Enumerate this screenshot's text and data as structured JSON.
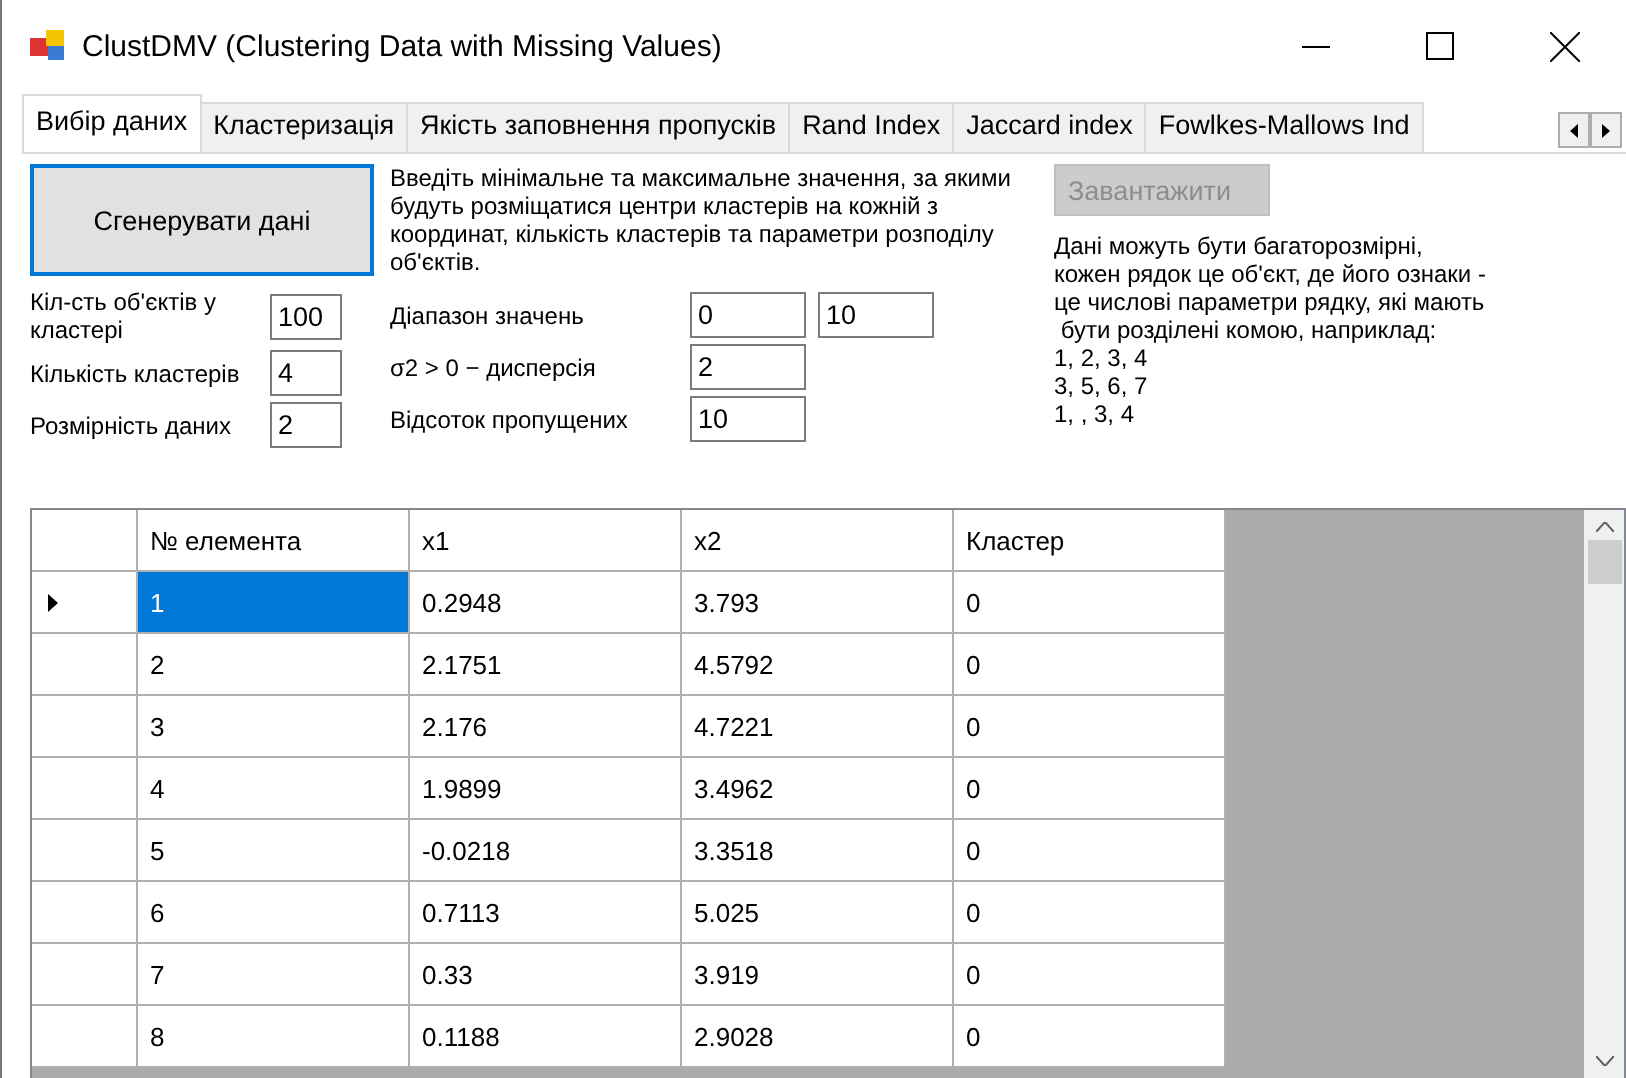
{
  "window": {
    "title": "ClustDMV (Clustering Data with Missing Values)"
  },
  "tabs": [
    {
      "label": "Вибір даних",
      "selected": true
    },
    {
      "label": "Кластеризація",
      "selected": false
    },
    {
      "label": "Якість заповнення пропусків",
      "selected": false
    },
    {
      "label": "Rand Index",
      "selected": false
    },
    {
      "label": "Jaccard index",
      "selected": false
    },
    {
      "label": "Fowlkes-Mallows Ind",
      "selected": false
    }
  ],
  "generate_button": {
    "label": "Сгенерувати дані"
  },
  "left_fields": [
    {
      "label": "Кіл-сть об'єктів у кластері",
      "value": "100"
    },
    {
      "label": "Кількість кластерів",
      "value": "4"
    },
    {
      "label": "Розмірність даних",
      "value": "2"
    }
  ],
  "instructions": "Введіть мінімальне та максимальне значення, за якими будуть розміщатися центри кластерів на кожній з координат, кількість кластерів та параметри розподілу об'єктів.",
  "middle_fields": [
    {
      "label": "Діапазон значень",
      "values": [
        "0",
        "10"
      ]
    },
    {
      "label": "σ2 > 0 − дисперсія",
      "values": [
        "2"
      ]
    },
    {
      "label": "Відсоток пропущених",
      "values": [
        "10"
      ]
    }
  ],
  "load_button": {
    "label": "Завантажити",
    "disabled": true
  },
  "load_help": [
    "Дані можуть бути багаторозмірні,",
    "кожен рядок це об'єкт, де його ознаки -",
    "це числові параметри рядку, які мають",
    " бути розділені комою, наприклад:",
    "1, 2, 3, 4",
    "3, 5, 6, 7",
    "1, , 3, 4"
  ],
  "table": {
    "columns": [
      "№ елемента",
      "x1",
      "x2",
      "Кластер"
    ],
    "rows": [
      {
        "cells": [
          "1",
          "0.2948",
          "3.793",
          "0"
        ],
        "selected": true
      },
      {
        "cells": [
          "2",
          "2.1751",
          "4.5792",
          "0"
        ],
        "selected": false
      },
      {
        "cells": [
          "3",
          "2.176",
          "4.7221",
          "0"
        ],
        "selected": false
      },
      {
        "cells": [
          "4",
          "1.9899",
          "3.4962",
          "0"
        ],
        "selected": false
      },
      {
        "cells": [
          "5",
          "-0.0218",
          "3.3518",
          "0"
        ],
        "selected": false
      },
      {
        "cells": [
          "6",
          "0.7113",
          "5.025",
          "0"
        ],
        "selected": false
      },
      {
        "cells": [
          "7",
          "0.33",
          "3.919",
          "0"
        ],
        "selected": false
      },
      {
        "cells": [
          "8",
          "0.1188",
          "2.9028",
          "0"
        ],
        "selected": false
      }
    ]
  }
}
